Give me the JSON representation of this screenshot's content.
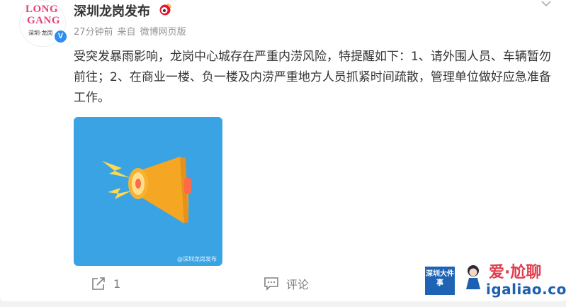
{
  "post": {
    "username": "深圳龙岗发布",
    "time": "27分钟前",
    "source_prefix": "来自",
    "source": "微博网页版",
    "text": "受突发暴雨影响，龙岗中心城存在严重内涝风险，特提醒如下：1、请外围人员、车辆暂勿前往；2、在商业一楼、负一楼及内涝严重地方人员抓紧时间疏散，管理单位做好应急准备工作。",
    "image_watermark": "@深圳龙岗发布"
  },
  "avatar": {
    "line1": "LONG",
    "line2": "GANG",
    "line3": "深圳·龙岗",
    "verified_mark": "V"
  },
  "actions": {
    "share_count": "1",
    "comment_label": "评论"
  },
  "watermarks": {
    "badge_text": "深圳大件事",
    "site_name": "爱·尬聊",
    "site_url": "igaliao.com"
  },
  "colors": {
    "accent_blue": "#3aa3e3",
    "megaphone_orange": "#f5a623",
    "megaphone_yellow": "#ffd84d",
    "verified_blue": "#2f8cf0",
    "text_gray": "#939393"
  },
  "icons": {
    "weibo_badge": "weibo-emblem-icon",
    "share": "share-icon",
    "comment": "comment-icon",
    "more": "chevron-down-icon",
    "megaphone": "megaphone-icon"
  }
}
